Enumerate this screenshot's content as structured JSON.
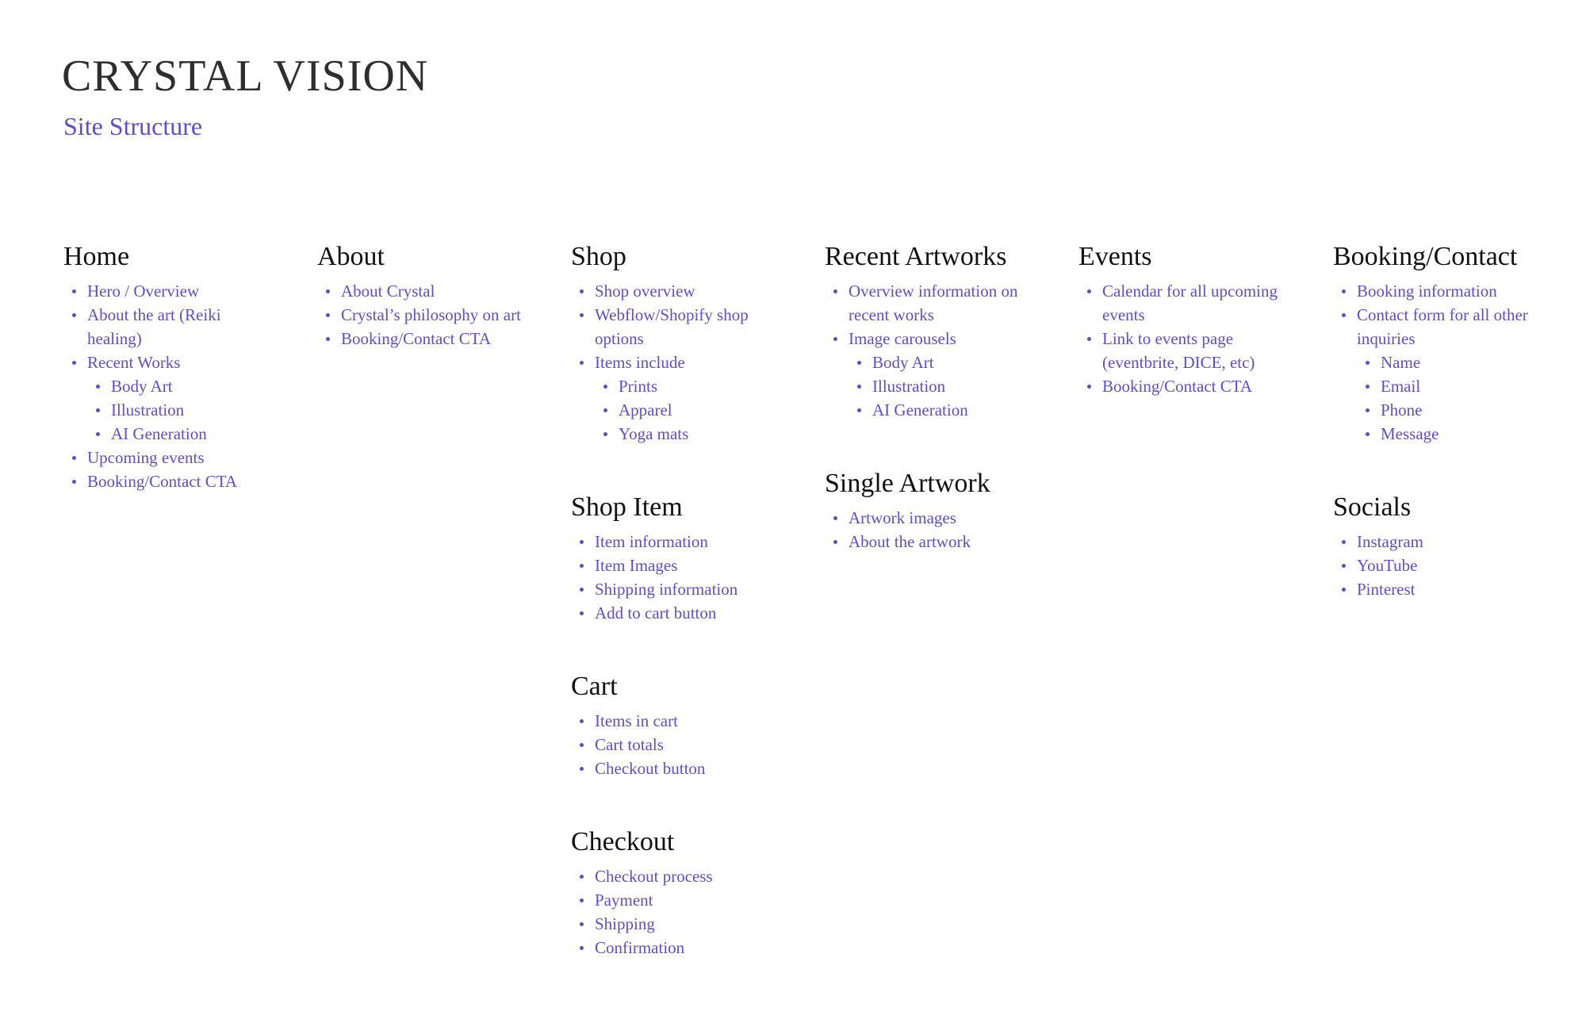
{
  "header": {
    "title": "CRYSTAL VISION",
    "subtitle": "Site Structure"
  },
  "colors": {
    "accent": "#5b4fcf",
    "heading": "#111111",
    "title": "#2e2e2e"
  },
  "sections": {
    "home": {
      "title": "Home",
      "items": [
        {
          "label": "Hero / Overview",
          "level": 1
        },
        {
          "label": "About the art (Reiki healing)",
          "level": 1
        },
        {
          "label": "Recent Works",
          "level": 1
        },
        {
          "label": "Body Art",
          "level": 2
        },
        {
          "label": "Illustration",
          "level": 2
        },
        {
          "label": "AI Generation",
          "level": 2
        },
        {
          "label": "Upcoming events",
          "level": 1
        },
        {
          "label": "Booking/Contact CTA",
          "level": 1
        }
      ]
    },
    "about": {
      "title": "About",
      "items": [
        {
          "label": "About Crystal",
          "level": 1
        },
        {
          "label": "Crystal’s philosophy on art",
          "level": 1
        },
        {
          "label": "Booking/Contact CTA",
          "level": 1
        }
      ]
    },
    "shop": {
      "title": "Shop",
      "items": [
        {
          "label": "Shop overview",
          "level": 1
        },
        {
          "label": "Webflow/Shopify shop options",
          "level": 1
        },
        {
          "label": "Items include",
          "level": 1
        },
        {
          "label": "Prints",
          "level": 2
        },
        {
          "label": "Apparel",
          "level": 2
        },
        {
          "label": "Yoga mats",
          "level": 2
        }
      ]
    },
    "shop_item": {
      "title": "Shop Item",
      "items": [
        {
          "label": "Item information",
          "level": 1
        },
        {
          "label": "Item Images",
          "level": 1
        },
        {
          "label": "Shipping information",
          "level": 1
        },
        {
          "label": "Add to cart button",
          "level": 1
        }
      ]
    },
    "cart": {
      "title": "Cart",
      "items": [
        {
          "label": "Items in cart",
          "level": 1
        },
        {
          "label": "Cart totals",
          "level": 1
        },
        {
          "label": "Checkout button",
          "level": 1
        }
      ]
    },
    "checkout": {
      "title": "Checkout",
      "items": [
        {
          "label": "Checkout process",
          "level": 1
        },
        {
          "label": "Payment",
          "level": 1
        },
        {
          "label": "Shipping",
          "level": 1
        },
        {
          "label": "Confirmation",
          "level": 1
        }
      ]
    },
    "recent_artworks": {
      "title": "Recent Artworks",
      "items": [
        {
          "label": "Overview information on recent works",
          "level": 1
        },
        {
          "label": "Image carousels",
          "level": 1
        },
        {
          "label": "Body Art",
          "level": 2
        },
        {
          "label": "Illustration",
          "level": 2
        },
        {
          "label": "AI Generation",
          "level": 2
        }
      ]
    },
    "single_artwork": {
      "title": "Single Artwork",
      "items": [
        {
          "label": "Artwork images",
          "level": 1
        },
        {
          "label": "About the artwork",
          "level": 1
        }
      ]
    },
    "events": {
      "title": "Events",
      "items": [
        {
          "label": "Calendar for all upcoming events",
          "level": 1
        },
        {
          "label": "Link to events page (eventbrite, DICE, etc)",
          "level": 1
        },
        {
          "label": "Booking/Contact CTA",
          "level": 1
        }
      ]
    },
    "booking_contact": {
      "title": "Booking/Contact",
      "items": [
        {
          "label": "Booking information",
          "level": 1
        },
        {
          "label": "Contact form for all other inquiries",
          "level": 1
        },
        {
          "label": "Name",
          "level": 2
        },
        {
          "label": "Email",
          "level": 2
        },
        {
          "label": "Phone",
          "level": 2
        },
        {
          "label": "Message",
          "level": 2
        }
      ]
    },
    "socials": {
      "title": "Socials",
      "items": [
        {
          "label": "Instagram",
          "level": 1
        },
        {
          "label": "YouTube",
          "level": 1
        },
        {
          "label": "Pinterest",
          "level": 1
        }
      ]
    }
  }
}
